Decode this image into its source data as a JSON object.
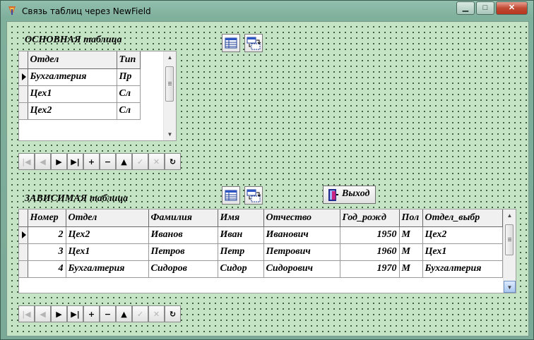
{
  "window": {
    "title": "Связь таблиц через NewField",
    "minimize_label": "▁",
    "maximize_label": "□",
    "close_label": "✕",
    "app_icon": "delphi-app-icon"
  },
  "master": {
    "caption": "ОСНОВНАЯ таблица",
    "columns": [
      "Отдел",
      "Тип"
    ],
    "rows": [
      [
        "Бухгалтерия",
        "Пр"
      ],
      [
        "Цех1",
        "Сл"
      ],
      [
        "Цех2",
        "Сл"
      ]
    ],
    "current_row": 0,
    "tool_icons": [
      "grid-view-icon",
      "field-link-icon"
    ]
  },
  "detail": {
    "caption": "ЗАВИСИМАЯ таблица",
    "columns": [
      "Номер",
      "Отдел",
      "Фамилия",
      "Имя",
      "Отчество",
      "Год_рожд",
      "Пол",
      "Отдел_выбр"
    ],
    "rows": [
      [
        "2",
        "Цех2",
        "Иванов",
        "Иван",
        "Иванович",
        "1950",
        "М",
        "Цех2"
      ],
      [
        "3",
        "Цех1",
        "Петров",
        "Петр",
        "Петрович",
        "1960",
        "М",
        "Цех1"
      ],
      [
        "4",
        "Бухгалтерия",
        "Сидоров",
        "Сидор",
        "Сидорович",
        "1970",
        "М",
        "Бухгалтерия"
      ]
    ],
    "current_row": 0,
    "tool_icons": [
      "grid-view-icon",
      "field-link-icon"
    ]
  },
  "navigator": {
    "buttons": [
      {
        "name": "first",
        "glyph": "|◀",
        "enabled": false
      },
      {
        "name": "prior",
        "glyph": "◀",
        "enabled": false
      },
      {
        "name": "next",
        "glyph": "▶",
        "enabled": true
      },
      {
        "name": "last",
        "glyph": "▶|",
        "enabled": true
      },
      {
        "name": "insert",
        "glyph": "+",
        "enabled": true
      },
      {
        "name": "delete",
        "glyph": "−",
        "enabled": true
      },
      {
        "name": "edit",
        "glyph": "▲",
        "enabled": true
      },
      {
        "name": "post",
        "glyph": "✓",
        "enabled": false
      },
      {
        "name": "cancel",
        "glyph": "✕",
        "enabled": false
      },
      {
        "name": "refresh",
        "glyph": "↻",
        "enabled": true
      }
    ]
  },
  "exit_button": {
    "label": "Выход",
    "icon": "exit-door-icon"
  }
}
